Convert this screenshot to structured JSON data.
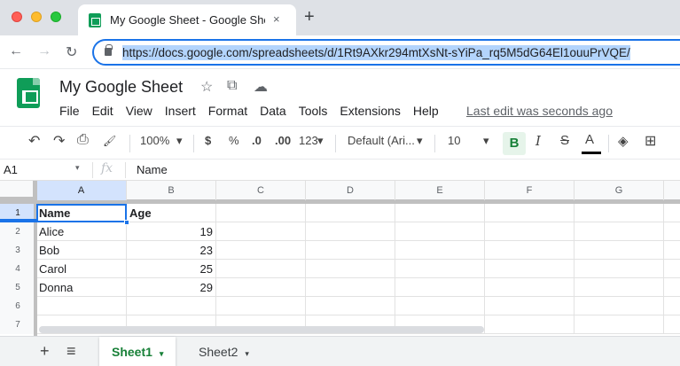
{
  "browser": {
    "tab_title": "My Google Sheet - Google Sheets",
    "tab_close": "×",
    "new_tab": "+",
    "back": "←",
    "forward": "→",
    "reload": "↻",
    "url": "https://docs.google.com/spreadsheets/d/1Rt9AXkr294mtXsNt-sYiPa_rq5M5dG64El1ouuPrVQE/"
  },
  "header": {
    "title": "My Google Sheet",
    "star_icon": "☆",
    "move_icon": "⧉",
    "cloud_icon": "☁",
    "menu": [
      "File",
      "Edit",
      "View",
      "Insert",
      "Format",
      "Data",
      "Tools",
      "Extensions",
      "Help"
    ],
    "last_edit": "Last edit was seconds ago"
  },
  "toolbar": {
    "undo": "↶",
    "redo": "↷",
    "print": "⎙",
    "paint": "🖌",
    "zoom": "100%",
    "currency": "$",
    "percent": "%",
    "dec_decrease": ".0",
    "dec_increase": ".00",
    "format_more": "123",
    "font": "Default (Ari...",
    "font_size": "10",
    "bold": "B",
    "italic": "I",
    "strike": "S",
    "font_color": "A",
    "fill": "◈",
    "borders": "⊞",
    "caret": "▾"
  },
  "formula_bar": {
    "cell_ref": "A1",
    "fx": "fx",
    "content": "Name"
  },
  "grid": {
    "columns": [
      "A",
      "B",
      "C",
      "D",
      "E",
      "F",
      "G"
    ],
    "rows": [
      {
        "num": "1",
        "a": "Name",
        "b": "Age"
      },
      {
        "num": "2",
        "a": "Alice",
        "b": "19"
      },
      {
        "num": "3",
        "a": "Bob",
        "b": "23"
      },
      {
        "num": "4",
        "a": "Carol",
        "b": "25"
      },
      {
        "num": "5",
        "a": "Donna",
        "b": "29"
      },
      {
        "num": "6",
        "a": "",
        "b": ""
      },
      {
        "num": "7",
        "a": "",
        "b": ""
      }
    ]
  },
  "sheets": {
    "add": "+",
    "all_sheets": "≡",
    "tabs": [
      "Sheet1",
      "Sheet2"
    ],
    "caret": "▾"
  },
  "colors": {
    "accent": "#1a73e8",
    "sheets_green": "#188038"
  }
}
